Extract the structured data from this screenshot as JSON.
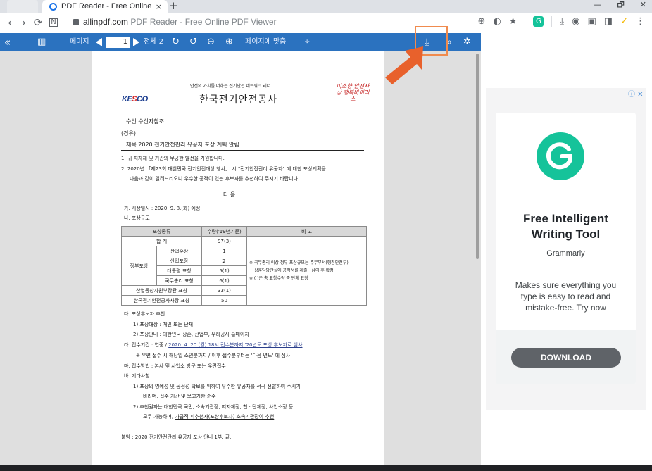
{
  "browser": {
    "tab_title": "PDF Reader - Free Online PDF",
    "tab_close": "×",
    "new_tab": "+",
    "window_controls": [
      "—",
      "🗗",
      "✕"
    ],
    "nav": [
      "‹",
      "›",
      "⟳",
      "N"
    ],
    "url_domain": "allinpdf.com",
    "url_rest": "PDF Reader - Free Online PDF Viewer",
    "extension_icons": [
      "⊕",
      "◐",
      "★",
      "G",
      "⤓",
      "◉",
      "▣",
      "◨",
      "✓",
      "⋮"
    ]
  },
  "toolbar": {
    "collapse_icon": "«",
    "sidebar_icon": "▥",
    "page_label": "페이지",
    "page_number": "1",
    "total_pages": "전체 2",
    "refresh_icon": "↻",
    "rotate_icon": "↺",
    "zoom_out_icon": "⊖",
    "zoom_in_icon": "⊕",
    "zoom_mode": "페이지에 맞춤",
    "zoom_mode_caret": "÷",
    "download_icon": "⤓",
    "search_icon": "⌕",
    "settings_icon": "✲"
  },
  "document": {
    "header_line": "안전의 가치를 더하는 전기안전 네트워크 리더",
    "logo_text": [
      "KE",
      "S",
      "CO"
    ],
    "org_name": "한국전기안전공사",
    "motto": "이소향 안전사상 행복바이러스",
    "recipient": "수신    수신자참조",
    "via": "(경유)",
    "subject": "제목    2020 전기안전관리 유공자 포상 계획 알림",
    "para1": "1. 귀 지자체 및 기관의 무궁한 발전을 기원합니다.",
    "para2a": "2. 2020년 「제23회 대한민국 전기안전대상 행사」 시 \"전기안전관리 유공자\" 에 대한 포상계획을",
    "para2b": "다음과 같이 알려드리오니 우수한 공적이 있는 후보자를 추천하여 주시기 바랍니다.",
    "next": "다          음",
    "item_ga": "가. 시상일시 : 2020. 9. 8.(화) 예정",
    "item_na": "나. 포상규모",
    "table": {
      "headers": [
        "포상종류",
        "수량('19년기준)",
        "비   고"
      ],
      "total_label": "합   계",
      "total_qty": "97(3)",
      "group_label": "정부포상",
      "rows": [
        {
          "name": "산업훈장",
          "qty": "1"
        },
        {
          "name": "산업포장",
          "qty": "2"
        },
        {
          "name": "대통령 표창",
          "qty": "5(1)"
        },
        {
          "name": "국무총리 표창",
          "qty": "6(1)"
        }
      ],
      "other_rows": [
        {
          "name": "산업통상자원부장관 표창",
          "qty": "33(1)"
        },
        {
          "name": "한국전기안전공사사장 표창",
          "qty": "50"
        }
      ],
      "note1": "※ 국무총리 이상 정부 포상규모는 주무부서(행정안전부)",
      "note2": "상훈담당관실에 공적서를 제출 · 심의 후 확정",
      "note3": "※ ( )은 총 표창수량 중 단체 표창"
    },
    "item_da": "다. 포상후보자 추천",
    "item_da1": "1) 포상대상 : 개인 또는 단체",
    "item_da2": "2) 포상안내 : 대한민국 상훈, 산업부, 우리공사 홈페이지",
    "item_ra_prefix": "라. 접수기간 : 연중 / ",
    "item_ra_link": "2020. 4. 20.(월) 18시 접수분까지 '20년도 포상 후보자로 심사",
    "item_ra_note": "※ 우편 접수 시 해당일 소인분까지 / 이후 접수분부터는 '다음 년도' 에 심사",
    "item_ma": "마. 접수방법 : 본사 및 사업소 방문 또는 우편접수",
    "item_ba": "바. 기타사항",
    "item_ba1a": "1) 포상의 영예성 및 공정성 확보를 위하여 우수한 유공자를 적극 선발하여 주시기",
    "item_ba1b": "바라며, 접수 기간 및 보고기한 준수",
    "item_ba2a": "2) 추천권자는 대한민국 국민, 소속기관장, 지자체장, 협 · 단체장, 사업소장 등",
    "item_ba2b_prefix": "모두 가능하며, ",
    "item_ba2b_link": "가급적 피추천자(포상후보자) 소속기관장이 추천",
    "attachment": "붙임 : 2020 전기안전관리 유공자 포상 안내 1부. 끝."
  },
  "ad": {
    "info_icon": "ⓘ ✕",
    "logo_letter": "G",
    "headline_1": "Free Intelligent",
    "headline_2": "Writing Tool",
    "brand": "Grammarly",
    "body": "Makes sure everything you type is easy to read and mistake-free. Try now",
    "cta": "DOWNLOAD"
  }
}
